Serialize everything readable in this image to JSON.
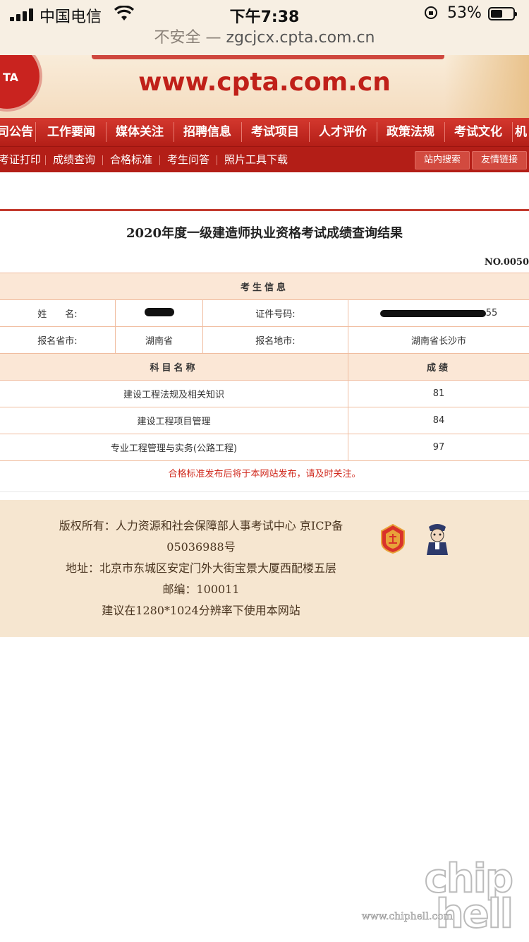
{
  "status_bar": {
    "carrier": "中国电信",
    "time": "下午7:38",
    "battery_percent": "53%",
    "battery_level": 0.53
  },
  "browser": {
    "security_label": "不安全 —",
    "host": "zgcjcx.cpta.com.cn"
  },
  "banner": {
    "logo_text": "TA",
    "site_text": "www.cpta.com.cn"
  },
  "main_nav": [
    "司公告",
    "工作要闻",
    "媒体关注",
    "招聘信息",
    "考试项目",
    "人才评价",
    "政策法规",
    "考试文化",
    "机"
  ],
  "sub_nav": {
    "links": [
      "考证打印",
      "成绩查询",
      "合格标准",
      "考生问答",
      "照片工具下载"
    ],
    "search_button": "站内搜索",
    "friend_links_button": "友情链接"
  },
  "result": {
    "title": "2020年度一级建造师执业资格考试成绩查询结果",
    "number": "NO.0050",
    "info_header": "考生信息",
    "name_label": "姓　　名:",
    "id_label": "证件号码:",
    "id_visible_tail": "55",
    "province_label": "报名省市:",
    "province_value": "湖南省",
    "city_label": "报名地市:",
    "city_value": "湖南省长沙市",
    "subject_header": "科目名称",
    "score_header": "成绩",
    "subjects": [
      {
        "name": "建设工程法规及相关知识",
        "score": "81"
      },
      {
        "name": "建设工程项目管理",
        "score": "84"
      },
      {
        "name": "专业工程管理与实务(公路工程)",
        "score": "97"
      }
    ],
    "notice": "合格标准发布后将于本网站发布，请及时关注。"
  },
  "footer": {
    "copyright": "版权所有：人力资源和社会保障部人事考试中心 京ICP备",
    "icp_number": "05036988号",
    "address": "地址：北京市东城区安定门外大街宝景大厦西配楼五层",
    "postcode": "邮编：100011",
    "resolution_note": "建议在1280*1024分辨率下使用本网站"
  },
  "watermark": {
    "brand": "chip hell",
    "url": "www.chiphell.com"
  },
  "colors": {
    "nav_red": "#c02019",
    "notice_red": "#d02a1e",
    "table_head": "#fbe7d6",
    "footer_bg": "#f6e6d0"
  }
}
